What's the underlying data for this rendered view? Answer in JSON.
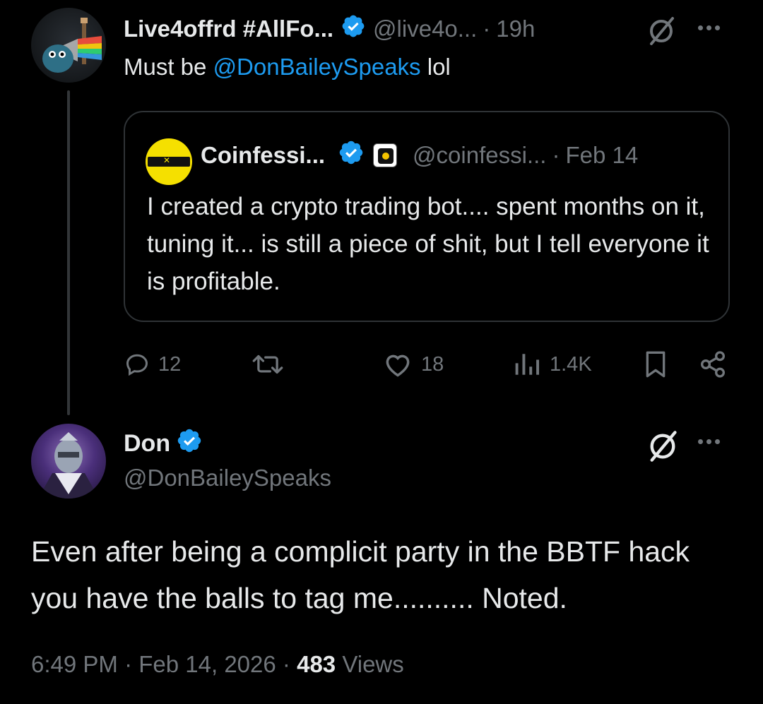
{
  "reply_tweet": {
    "author_name": "Live4offrd #AllFo...",
    "handle": "@live4o...",
    "separator": "·",
    "time": "19h",
    "text_prefix": "Must be ",
    "mention": "@DonBaileySpeaks",
    "text_suffix": " lol",
    "verified": true
  },
  "quoted_tweet": {
    "author_name": "Coinfessi...",
    "handle": "@coinfessi...",
    "separator": "·",
    "date": "Feb 14",
    "text": "I created a crypto trading bot.... spent months on it, tuning it... is still a piece of shit, but I tell everyone it is profitable.",
    "verified": true
  },
  "actions": {
    "replies": "12",
    "reposts": "",
    "likes": "18",
    "views": "1.4K"
  },
  "main_tweet": {
    "author_name": "Don",
    "handle": "@DonBaileySpeaks",
    "text": "Even after being a complicit party in the BBTF hack you have the balls to tag me.......... Noted.",
    "time": "6:49 PM",
    "separator": "·",
    "date": "Feb 14, 2026",
    "separator2": "·",
    "views_count": "483",
    "views_label": " Views",
    "verified": true
  },
  "colors": {
    "background": "#000000",
    "text": "#e7e9ea",
    "muted": "#71767b",
    "link": "#1d9bf0",
    "verified": "#1d9bf0",
    "border": "#2f3336"
  }
}
